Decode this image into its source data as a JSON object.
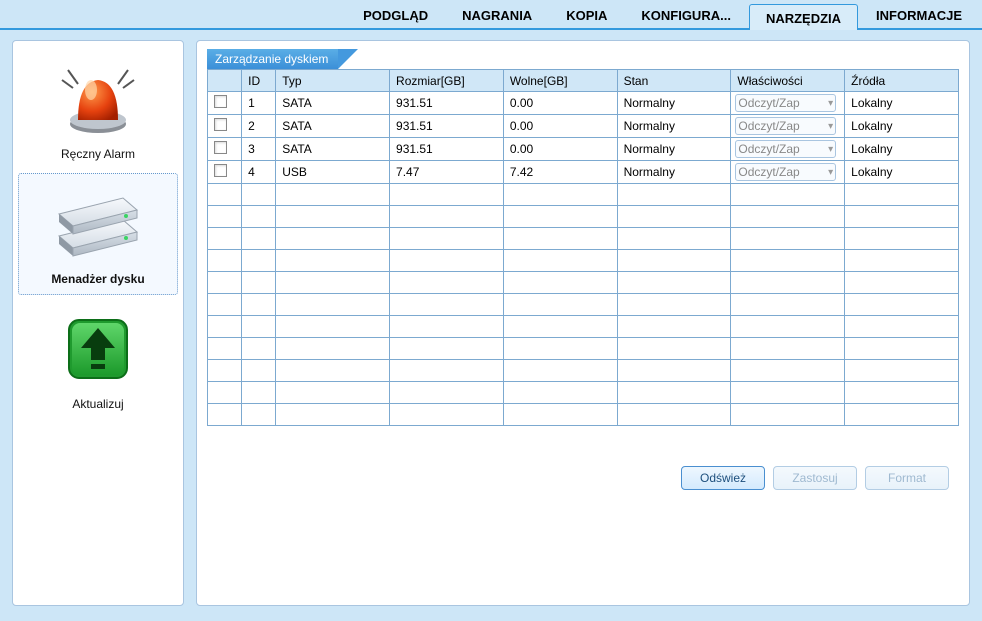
{
  "tabs": {
    "items": [
      {
        "label": "PODGLĄD",
        "active": false
      },
      {
        "label": "NAGRANIA",
        "active": false
      },
      {
        "label": "KOPIA",
        "active": false
      },
      {
        "label": "KONFIGURA...",
        "active": false
      },
      {
        "label": "NARZĘDZIA",
        "active": true
      },
      {
        "label": "INFORMACJE",
        "active": false
      }
    ]
  },
  "sidebar": {
    "items": [
      {
        "label": "Ręczny Alarm",
        "selected": false
      },
      {
        "label": "Menadżer dysku",
        "selected": true
      },
      {
        "label": "Aktualizuj",
        "selected": false
      }
    ]
  },
  "panel": {
    "title": "Zarządzanie dyskiem",
    "columns": {
      "chk": "",
      "id": "ID",
      "type": "Typ",
      "size": "Rozmiar[GB]",
      "free": "Wolne[GB]",
      "state": "Stan",
      "prop": "Właściwości",
      "src": "Źródła"
    },
    "rows": [
      {
        "id": "1",
        "type": "SATA",
        "size": "931.51",
        "free": "0.00",
        "state": "Normalny",
        "prop": "Odczyt/Zap",
        "src": "Lokalny"
      },
      {
        "id": "2",
        "type": "SATA",
        "size": "931.51",
        "free": "0.00",
        "state": "Normalny",
        "prop": "Odczyt/Zap",
        "src": "Lokalny"
      },
      {
        "id": "3",
        "type": "SATA",
        "size": "931.51",
        "free": "0.00",
        "state": "Normalny",
        "prop": "Odczyt/Zap",
        "src": "Lokalny"
      },
      {
        "id": "4",
        "type": "USB",
        "size": "7.47",
        "free": "7.42",
        "state": "Normalny",
        "prop": "Odczyt/Zap",
        "src": "Lokalny"
      }
    ],
    "empty_row_count": 11
  },
  "buttons": {
    "refresh": "Odśwież",
    "apply": "Zastosuj",
    "format": "Format"
  }
}
